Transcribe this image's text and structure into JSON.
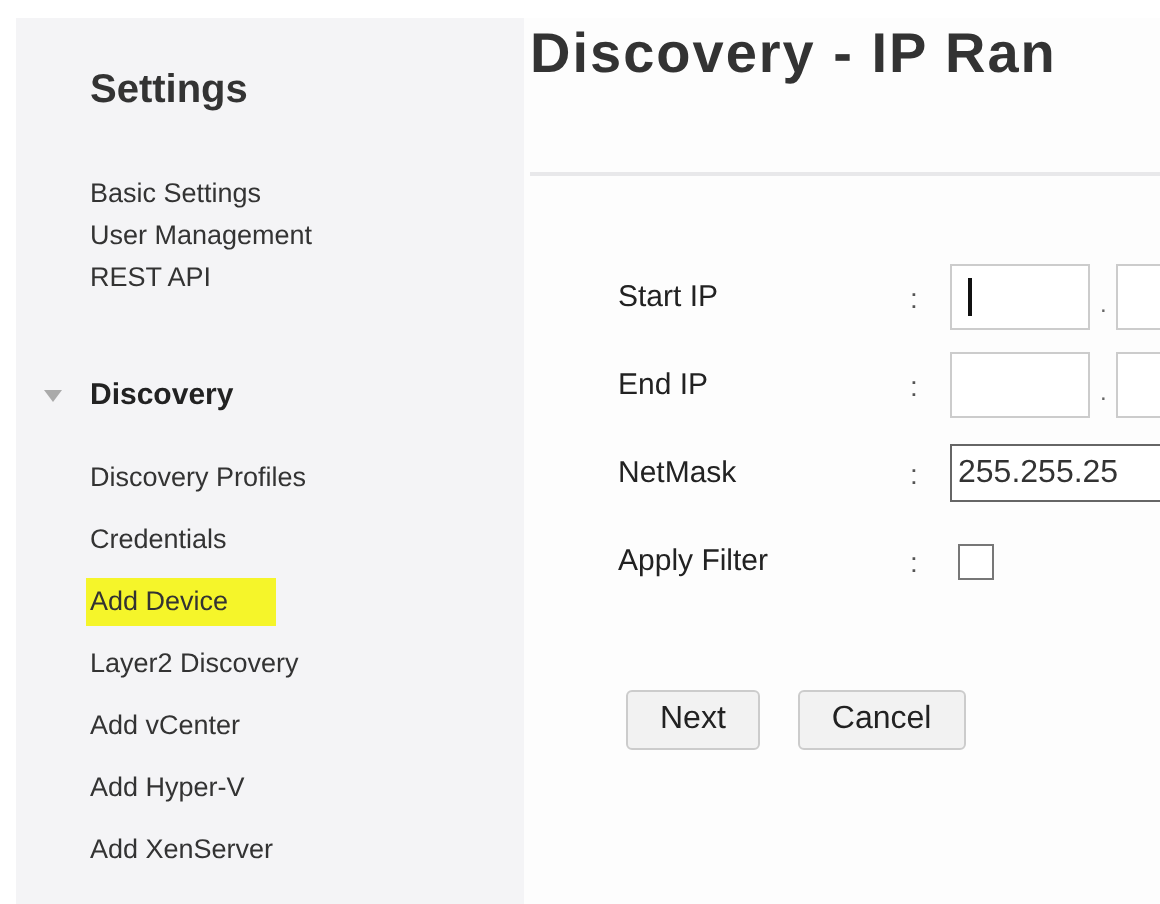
{
  "sidebar": {
    "title": "Settings",
    "groups": [
      {
        "kind": "plain",
        "items": [
          {
            "label": "Basic Settings",
            "highlighted": false
          },
          {
            "label": "User Management",
            "highlighted": false
          },
          {
            "label": "REST API",
            "highlighted": false
          }
        ]
      },
      {
        "kind": "section",
        "title": "Discovery",
        "expanded": true,
        "items": [
          {
            "label": "Discovery Profiles",
            "highlighted": false
          },
          {
            "label": "Credentials",
            "highlighted": false
          },
          {
            "label": "Add Device",
            "highlighted": true
          },
          {
            "label": "Layer2 Discovery",
            "highlighted": false
          },
          {
            "label": "Add vCenter",
            "highlighted": false
          },
          {
            "label": "Add Hyper-V",
            "highlighted": false
          },
          {
            "label": "Add XenServer",
            "highlighted": false
          }
        ]
      }
    ]
  },
  "main": {
    "title": "Discovery - IP Ran",
    "fields": [
      {
        "kind": "octets",
        "label": "Start IP",
        "colon": ":",
        "separator": ".",
        "cursor": true
      },
      {
        "kind": "octets",
        "label": "End IP",
        "colon": ":",
        "separator": ".",
        "cursor": false
      },
      {
        "kind": "text",
        "label": "NetMask",
        "colon": ":",
        "value": "255.255.25"
      },
      {
        "kind": "checkbox",
        "label": "Apply Filter",
        "colon": ":",
        "checked": false
      }
    ],
    "buttons": [
      "Next",
      "Cancel"
    ]
  }
}
